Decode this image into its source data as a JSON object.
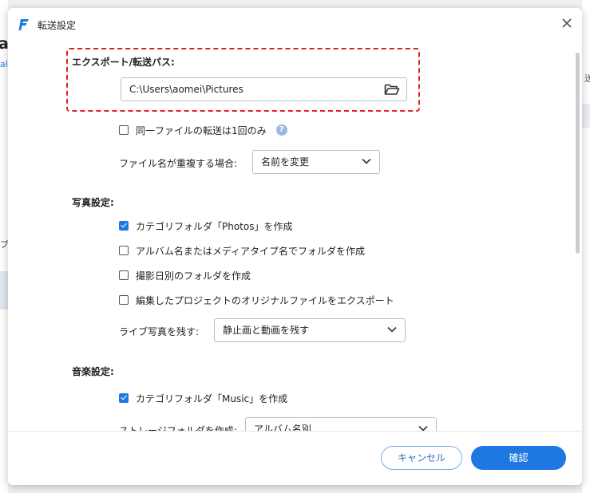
{
  "background": {
    "left_letter": "a",
    "left_link": "al",
    "left_text": "プ",
    "right_text": "送"
  },
  "dialog": {
    "title": "転送設定",
    "close_icon": "close-icon",
    "logo_icon": "app-logo-icon"
  },
  "export": {
    "label": "エクスポート/転送パス:",
    "path_value": "C:\\Users\\aomei\\Pictures",
    "browse_icon": "folder-open-icon"
  },
  "options": {
    "same_file_once": {
      "label": "同一ファイルの転送は1回のみ",
      "checked": false,
      "help": "?"
    },
    "duplicate_name": {
      "label": "ファイル名が重複する場合:",
      "value": "名前を変更"
    }
  },
  "photos": {
    "heading": "写真設定:",
    "items": [
      {
        "label": "カテゴリフォルダ「Photos」を作成",
        "checked": true
      },
      {
        "label": "アルバム名またはメディアタイプ名でフォルダを作成",
        "checked": false
      },
      {
        "label": "撮影日別のフォルダを作成",
        "checked": false
      },
      {
        "label": "編集したプロジェクトのオリジナルファイルをエクスポート",
        "checked": false
      }
    ],
    "live_photo": {
      "label": "ライブ写真を残す:",
      "value": "静止画と動画を残す"
    }
  },
  "music": {
    "heading": "音楽設定:",
    "items": [
      {
        "label": "カテゴリフォルダ「Music」を作成",
        "checked": true
      }
    ],
    "storage": {
      "label": "ストレージフォルダを作成:",
      "value": "アルバム名別"
    }
  },
  "footer": {
    "cancel_label": "キャンセル",
    "ok_label": "確認"
  },
  "colors": {
    "accent": "#1f78e2",
    "highlight_border": "#e0211d"
  }
}
